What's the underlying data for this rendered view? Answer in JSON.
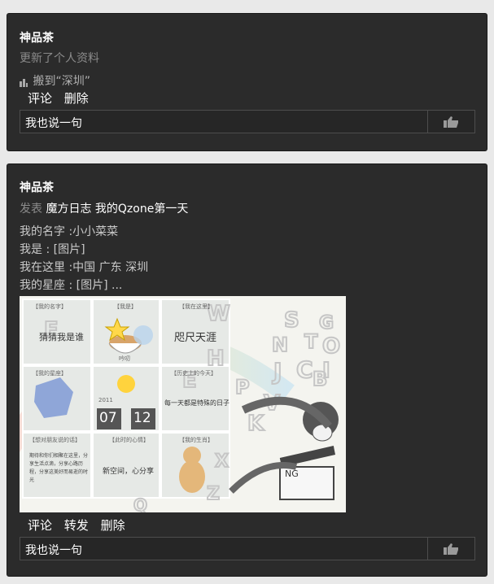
{
  "post1": {
    "author": "神品茶",
    "subtitle": "更新了个人资料",
    "moved_text": "搬到“深圳”",
    "actions": [
      "评论",
      "删除"
    ],
    "reply_placeholder": "我也说一句"
  },
  "post2": {
    "author": "神品茶",
    "published_prefix": "发表",
    "source": "魔方日志",
    "post_title": "我的Qzone第一天",
    "lines": [
      "我的名字 :小小菜菜",
      "我是 : [图片]",
      "我在这里 :中国 广东 深圳",
      "我的星座 : [图片] ..."
    ],
    "image": {
      "cells": [
        {
          "title": "【我的名字】",
          "text": "猜猜我是谁"
        },
        {
          "title": "【我是】",
          "text": "吟叨"
        },
        {
          "title": "【我在这里】",
          "text": "咫尺天涯"
        },
        {
          "title": "【我的星座】",
          "text": ""
        },
        {
          "title": "2011",
          "text": ""
        },
        {
          "title": "【历史上的今天】",
          "text": "每一天都是特殊的日子"
        },
        {
          "title": "【想对朋友说的话】",
          "text": "期待和你们相聚在这里，分享生活点滴，分享心路历程，分享这美好而易逝的时光"
        },
        {
          "title": "【此时的心情】",
          "text": "新空间，心分享"
        },
        {
          "title": "【我的生肖】",
          "text": ""
        }
      ],
      "date_month": "07",
      "date_day": "12",
      "sign_text": "NG"
    },
    "actions": [
      "评论",
      "转发",
      "删除"
    ],
    "reply_placeholder": "我也说一句"
  }
}
